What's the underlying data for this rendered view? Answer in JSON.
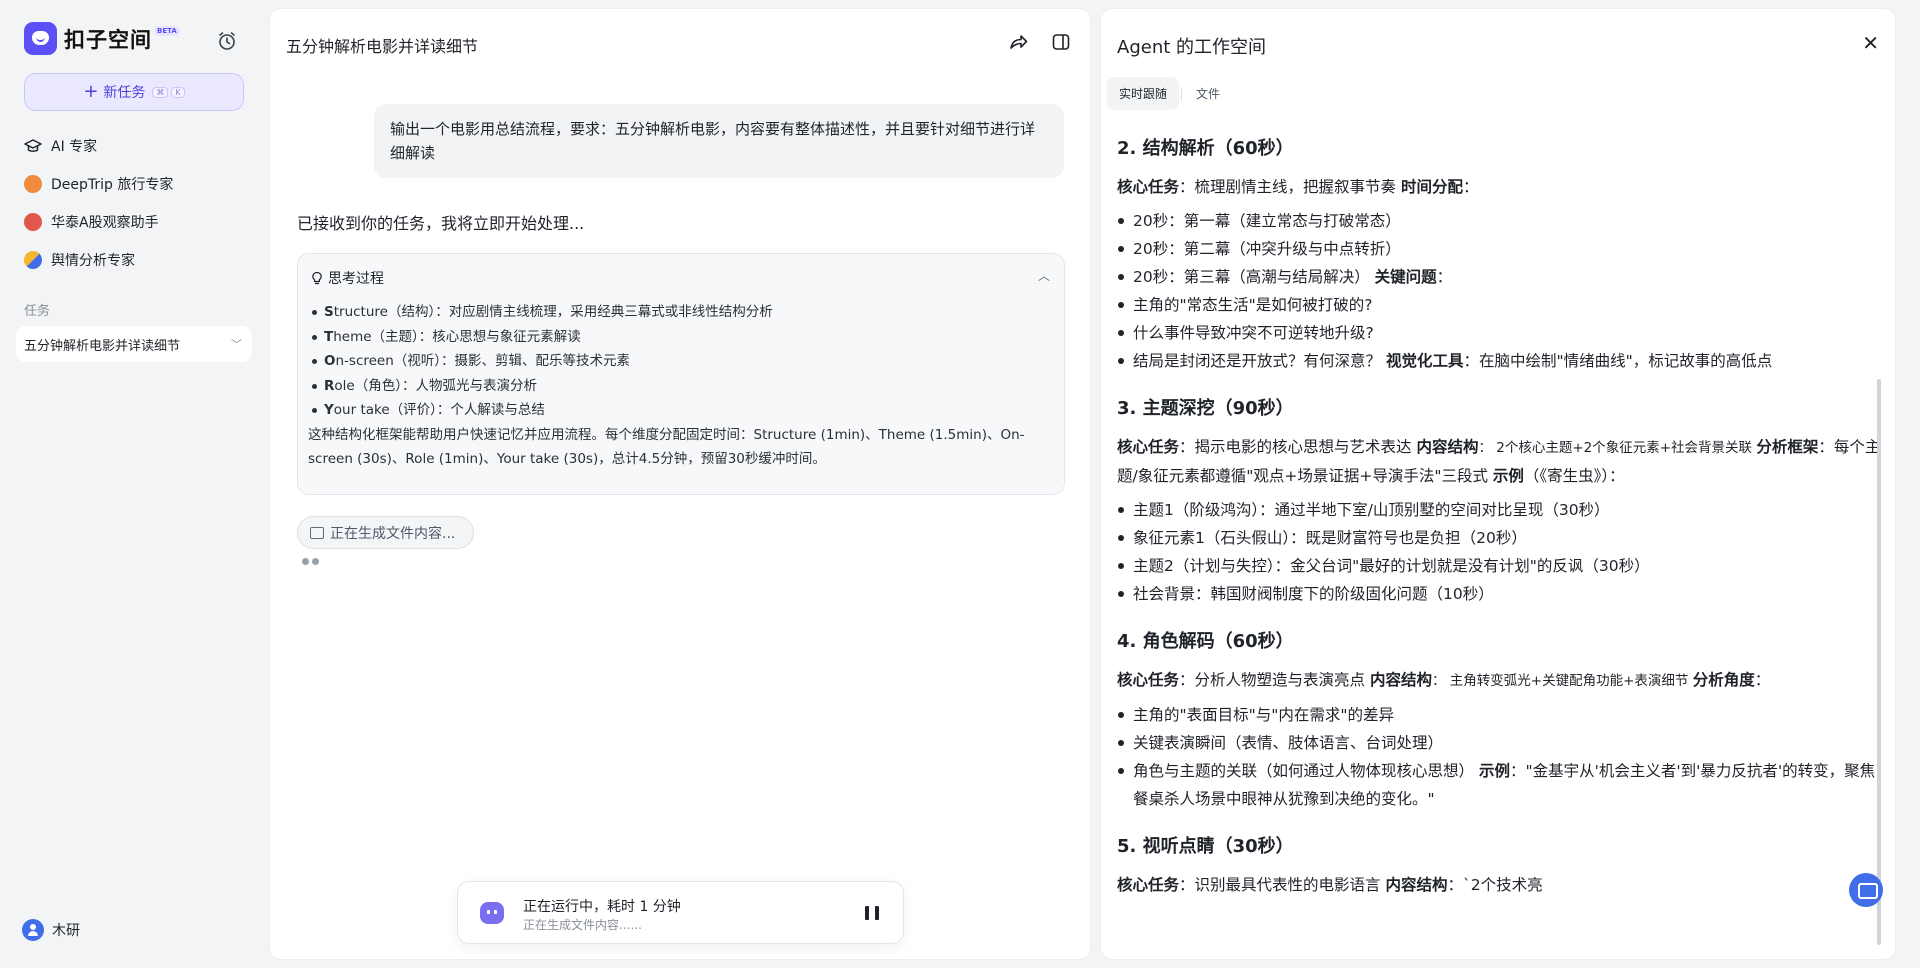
{
  "app": {
    "name": "扣子空间",
    "badge": "BETA"
  },
  "sidebar": {
    "new_task": {
      "label": "新任务",
      "shortcut_1": "⌘",
      "shortcut_2": "K"
    },
    "items": [
      {
        "label": "AI 专家",
        "icon": "graduation-cap-icon"
      },
      {
        "label": "DeepTrip 旅行专家",
        "icon": "deeptrip-icon"
      },
      {
        "label": "华泰A股观察助手",
        "icon": "huatai-icon"
      },
      {
        "label": "舆情分析专家",
        "icon": "sentiment-icon"
      }
    ],
    "section_label": "任务",
    "tasks": [
      {
        "label": "五分钟解析电影并详读细节"
      }
    ],
    "user": {
      "name": "木研"
    }
  },
  "chat": {
    "title": "五分钟解析电影并详读细节",
    "user_message": "输出一个电影用总结流程，要求：五分钟解析电影，内容要有整体描述性，并且要针对细节进行详细解读",
    "reply": "已接收到你的任务，我将立即开始处理...",
    "thinking": {
      "title": "思考过程",
      "items": [
        {
          "initial": "S",
          "rest": "tructure（结构）：对应剧情主线梳理，采用经典三幕式或非线性结构分析"
        },
        {
          "initial": "T",
          "rest": "heme（主题）：核心思想与象征元素解读"
        },
        {
          "initial": "O",
          "rest": "n-screen（视听）：摄影、剪辑、配乐等技术元素"
        },
        {
          "initial": "R",
          "rest": "ole（角色）：人物弧光与表演分析"
        },
        {
          "initial": "Y",
          "rest": "our take（评价）：个人解读与总结"
        }
      ],
      "paragraph": "这种结构化框架能帮助用户快速记忆并应用流程。每个维度分配固定时间：Structure (1min)、Theme (1.5min)、On-screen (30s)、Role (1min)、Your take (30s)，总计4.5分钟，预留30秒缓冲时间。"
    },
    "generating_chip": "正在生成文件内容...",
    "status": {
      "main": "正在运行中，耗时 1 分钟",
      "sub": "正在生成文件内容......"
    }
  },
  "workspace": {
    "title": "Agent 的工作空间",
    "tabs": [
      "实时跟随",
      "文件"
    ],
    "sections": [
      {
        "heading": "2. 结构解析（60秒）",
        "intro_label": "核心任务",
        "intro_text": "：梳理剧情主线，把握叙事节奏 ",
        "intro_label2": "时间分配",
        "intro_tail": "：",
        "bullets": [
          "20秒：第一幕（建立常态与打破常态）",
          "20秒：第二幕（冲突升级与中点转折）",
          "20秒：第三幕（高潮与结局解决） ",
          "主角的\"常态生活\"是如何被打破的?",
          "什么事件导致冲突不可逆转地升级?",
          "结局是封闭还是开放式？有何深意？ "
        ],
        "b3_label": "关键问题",
        "b3_tail": "：",
        "b6_label": "视觉化工具",
        "b6_tail": "：在脑中绘制\"情绪曲线\"，标记故事的高低点"
      },
      {
        "heading": "3. 主题深挖（90秒）",
        "intro_label": "核心任务",
        "intro_text": "：揭示电影的核心思想与艺术表达 ",
        "intro_label2": "内容结构",
        "intro_small": "： 2个核心主题+2个象征元素+社会背景关联 ",
        "intro_label3": "分析框架",
        "intro_text3": "：每个主题/象征元素都遵循\"观点+场景证据+导演手法\"三段式 ",
        "intro_label4": "示例",
        "intro_text4": "（《寄生虫》）：",
        "bullets": [
          "主题1（阶级鸿沟）：通过半地下室/山顶别墅的空间对比呈现（30秒）",
          "象征元素1（石头假山）：既是财富符号也是负担（20秒）",
          "主题2（计划与失控）：金父台词\"最好的计划就是没有计划\"的反讽（30秒）",
          "社会背景：韩国财阀制度下的阶级固化问题（10秒）"
        ]
      },
      {
        "heading": "4. 角色解码（60秒）",
        "intro_label": "核心任务",
        "intro_text": "：分析人物塑造与表演亮点 ",
        "intro_label2": "内容结构",
        "intro_small": "： 主角转变弧光+关键配角功能+表演细节 ",
        "intro_label3": "分析角度",
        "intro_tail": "：",
        "bullets": [
          "主角的\"表面目标\"与\"内在需求\"的差异",
          "关键表演瞬间（表情、肢体语言、台词处理）",
          "角色与主题的关联（如何通过人物体现核心思想） "
        ],
        "b3_label": "示例",
        "b3_tail": "：\"金基宇从'机会主义者'到'暴力反抗者'的转变，聚焦餐桌杀人场景中眼神从犹豫到决绝的变化。\""
      },
      {
        "heading": "5. 视听点睛（30秒）",
        "intro_label": "核心任务",
        "intro_text": "：识别最具代表性的电影语言 ",
        "intro_label2": "内容结构",
        "intro_tail": "：`2个技术亮"
      }
    ]
  },
  "colors": {
    "brand": "#5b4ff5",
    "new_task_bg": "#ebe9ff",
    "fab": "#3f6ee8"
  }
}
